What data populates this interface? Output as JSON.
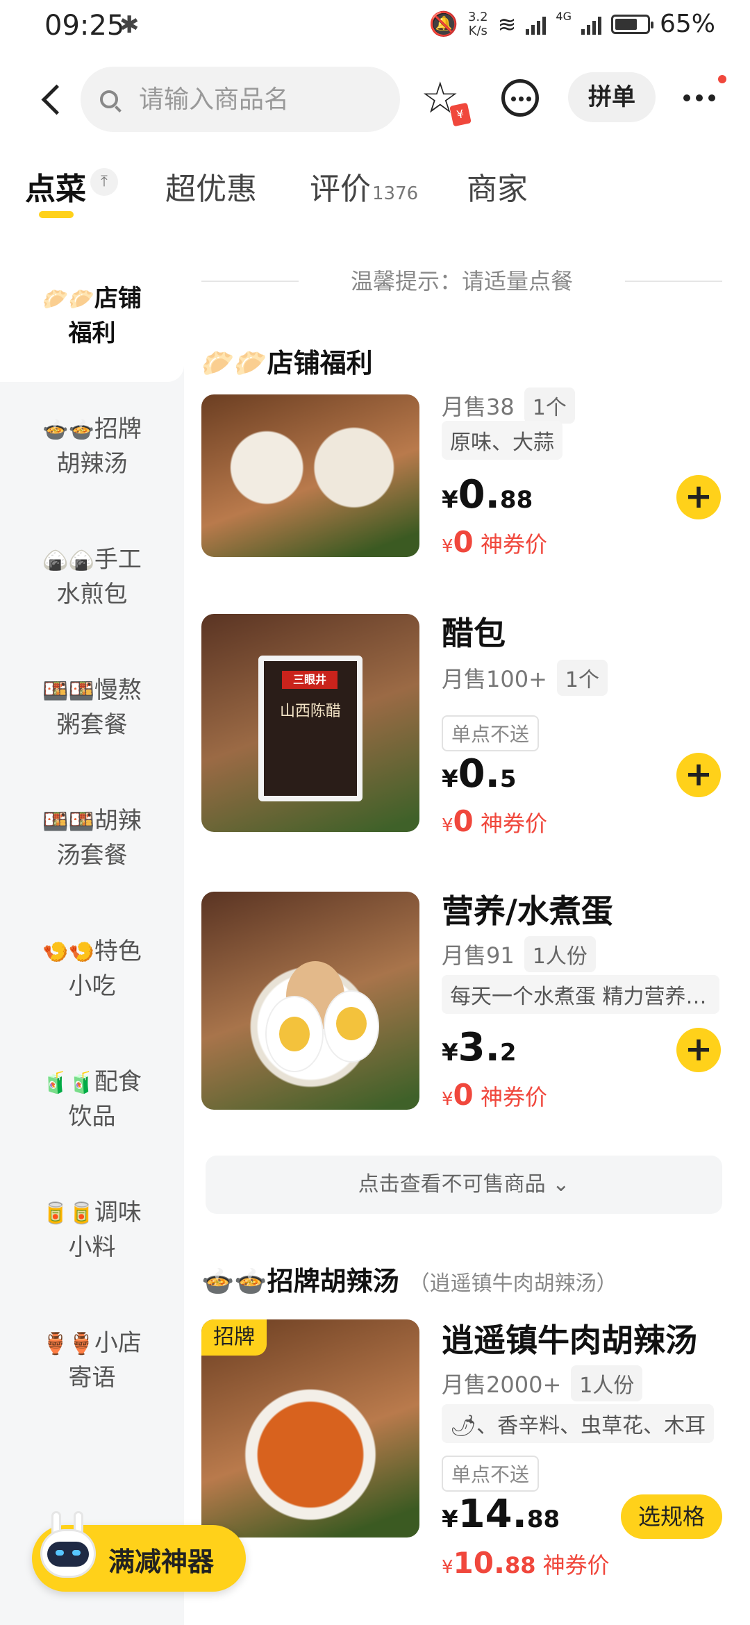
{
  "status_bar": {
    "time": "09:25",
    "net_speed_value": "3.2",
    "net_speed_unit": "K/s",
    "signal_type": "4G",
    "battery": "65%"
  },
  "top_bar": {
    "search_placeholder": "请输入商品名",
    "pin_label": "拼单",
    "star_badge": "¥"
  },
  "tabs": [
    {
      "label": "点菜",
      "active": true
    },
    {
      "label": "超优惠"
    },
    {
      "label": "评价",
      "count": "1376"
    },
    {
      "label": "商家"
    }
  ],
  "sidebar": {
    "items": [
      {
        "emoji": "🥟🥟",
        "line1": "店铺",
        "line2": "福利",
        "active": true
      },
      {
        "emoji": "🍲🍲",
        "line1": "招牌",
        "line2": "胡辣汤"
      },
      {
        "emoji": "🍙🍙",
        "line1": "手工",
        "line2": "水煎包"
      },
      {
        "emoji": "🍱🍱",
        "line1": "慢熬",
        "line2": "粥套餐"
      },
      {
        "emoji": "🍱🍱",
        "line1": "胡辣",
        "line2": "汤套餐"
      },
      {
        "emoji": "🍤🍤",
        "line1": "特色",
        "line2": "小吃"
      },
      {
        "emoji": "🧃🧃",
        "line1": "配食",
        "line2": "饮品"
      },
      {
        "emoji": "🥫🥫",
        "line1": "调味",
        "line2": "小料"
      },
      {
        "emoji": "🏺🏺",
        "line1": "小店",
        "line2": "寄语"
      }
    ]
  },
  "main": {
    "notice": "温馨提示：请适量点餐",
    "section1": {
      "emoji": "🥟🥟",
      "title": "店铺福利"
    },
    "products": [
      {
        "sales": "月售38",
        "unit": "1个",
        "desc": "原味、大蒜",
        "price_symbol": "¥",
        "price_int": "0.",
        "price_dec": "88",
        "coupon_symbol": "¥",
        "coupon_value": "0",
        "coupon_label": "神券价"
      },
      {
        "name": "醋包",
        "sales": "月售100+",
        "unit": "1个",
        "no_ship": "单点不送",
        "pack_brand": "三眼井",
        "pack_text": "山西陈醋",
        "price_symbol": "¥",
        "price_int": "0.",
        "price_dec": "5",
        "coupon_symbol": "¥",
        "coupon_value": "0",
        "coupon_label": "神券价"
      },
      {
        "name": "营养/水煮蛋",
        "sales": "月售91",
        "unit": "1人份",
        "desc": "每天一个水煮蛋 精力营养满满",
        "price_symbol": "¥",
        "price_int": "3.",
        "price_dec": "2",
        "coupon_symbol": "¥",
        "coupon_value": "0",
        "coupon_label": "神券价"
      }
    ],
    "unavailable_label": "点击查看不可售商品",
    "section2": {
      "emoji": "🍲🍲",
      "title": "招牌胡辣汤",
      "subtitle": "（逍遥镇牛肉胡辣汤）"
    },
    "featured": {
      "tag": "招牌",
      "name": "逍遥镇牛肉胡辣汤",
      "sales": "月售2000+",
      "unit": "1人份",
      "desc": "🌶、香辛料、虫草花、木耳",
      "no_ship": "单点不送",
      "price_symbol": "¥",
      "price_int": "14.",
      "price_dec": "88",
      "coupon_symbol": "¥",
      "coupon_int": "10.",
      "coupon_dec": "88",
      "coupon_label": "神券价",
      "spec_label": "选规格"
    }
  },
  "float_button": {
    "label": "满减神器"
  },
  "colors": {
    "accent": "#ffd11a",
    "price_red": "#f0473c",
    "sidebar_bg": "#f5f6f7"
  }
}
